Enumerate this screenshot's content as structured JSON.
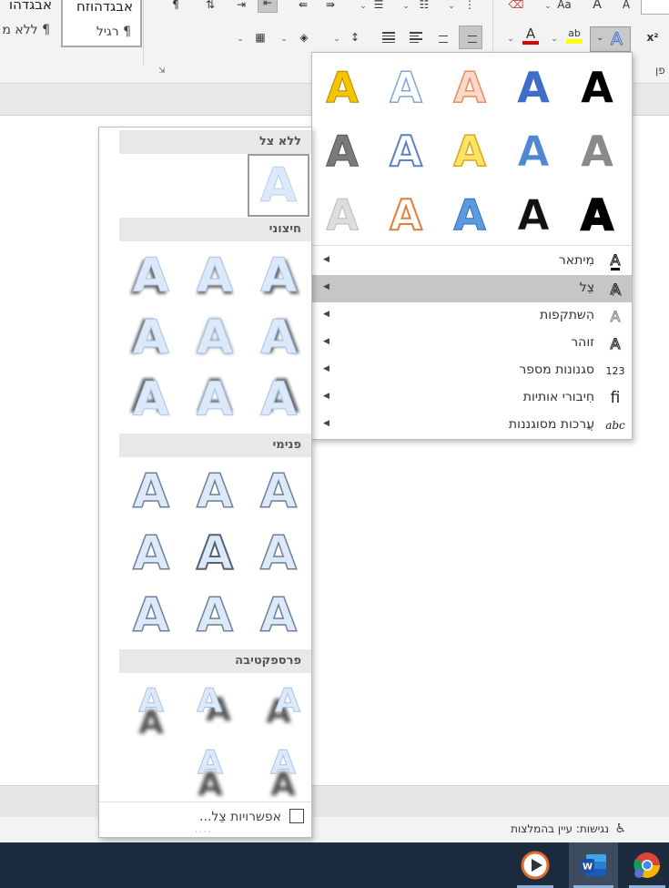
{
  "ribbon": {
    "styles": [
      {
        "name": "אבגדהוזח",
        "sub": "¶ רגיל"
      },
      {
        "name": "אבגדהו",
        "sub": "¶ ללא מ"
      }
    ],
    "label_fragment": "פן",
    "superscript": "x²",
    "font_aa": "Aa",
    "font_a1": "A",
    "font_a2": "A",
    "font_color_a": "A",
    "text_effects_a": "A",
    "highlight_ab": "ab",
    "pilcrow": "¶"
  },
  "effects_menu": {
    "gallery_glyph": "A",
    "items": [
      {
        "label": "מִיתאר",
        "icon": "A"
      },
      {
        "label": "צֵל",
        "icon": "A"
      },
      {
        "label": "הִשתקפות",
        "icon": "A"
      },
      {
        "label": "זוהר",
        "icon": "A"
      },
      {
        "label": "סגנונות מספר",
        "icon": "123"
      },
      {
        "label": "חִיבורי אותיות",
        "icon": "fi"
      },
      {
        "label": "עֲרכות מסוגננות",
        "icon": "abc"
      }
    ]
  },
  "shadow_menu": {
    "glyph": "A",
    "sections": {
      "none": "ללא צל",
      "outer": "חיצוני",
      "inner": "פנימי",
      "perspective": "פרספקטיבה"
    },
    "options_label": "אפשרויות צֵל..."
  },
  "status": {
    "accessibility": "נגישות: עיין בהמלצות"
  },
  "colors": {
    "highlight_row": "#c6c6c6",
    "section_header": "#e8e8e8",
    "font_color_red": "#e00000",
    "highlight_yellow": "#ffff00",
    "taskbar": "#1c2b3d",
    "word_blue": "#2b579a"
  }
}
